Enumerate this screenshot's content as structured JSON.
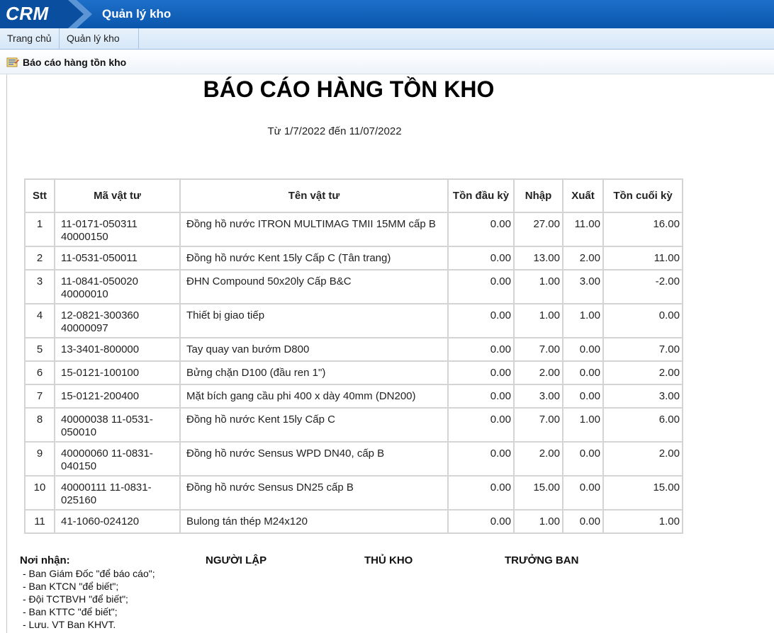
{
  "header": {
    "logo": "CRM",
    "app_title": "Quản lý kho",
    "colors": {
      "topbar": "#0a56ad",
      "menubar": "#dbe9f8"
    }
  },
  "menu": {
    "home": "Trang chủ",
    "warehouse": "Quản lý kho"
  },
  "subbar": {
    "icon": "report-icon",
    "label": "Báo cáo hàng tồn kho"
  },
  "report": {
    "title": "BÁO CÁO HÀNG TỒN KHO",
    "date_range": "Từ 1/7/2022 đến 11/07/2022",
    "columns": [
      "Stt",
      "Mã vật tư",
      "Tên vật tư",
      "Tồn đầu kỳ",
      "Nhập",
      "Xuất",
      "Tồn cuối kỳ"
    ],
    "rows": [
      {
        "stt": "1",
        "ma_line1": "11-0171-050311",
        "ma_line2": "40000150",
        "ten": "Đồng hồ nước ITRON MULTIMAG TMII 15MM cấp B",
        "ton_dau": "0.00",
        "nhap": "27.00",
        "xuat": "11.00",
        "ton_cuoi": "16.00"
      },
      {
        "stt": "2",
        "ma_line1": "11-0531-050011",
        "ma_line2": "",
        "ten": "Đồng hồ nước Kent 15ly Cấp C (Tân trang)",
        "ton_dau": "0.00",
        "nhap": "13.00",
        "xuat": "2.00",
        "ton_cuoi": "11.00"
      },
      {
        "stt": "3",
        "ma_line1": "11-0841-050020",
        "ma_line2": "40000010",
        "ten": "ĐHN Compound 50x20ly Cấp B&C",
        "ton_dau": "0.00",
        "nhap": "1.00",
        "xuat": "3.00",
        "ton_cuoi": "-2.00"
      },
      {
        "stt": "4",
        "ma_line1": "12-0821-300360",
        "ma_line2": "40000097",
        "ten": "Thiết bị giao tiếp",
        "ton_dau": "0.00",
        "nhap": "1.00",
        "xuat": "1.00",
        "ton_cuoi": "0.00"
      },
      {
        "stt": "5",
        "ma_line1": "13-3401-800000",
        "ma_line2": "",
        "ten": "Tay quay van bướm D800",
        "ton_dau": "0.00",
        "nhap": "7.00",
        "xuat": "0.00",
        "ton_cuoi": "7.00"
      },
      {
        "stt": "6",
        "ma_line1": "15-0121-100100",
        "ma_line2": "",
        "ten": "Bửng chặn D100 (đầu ren 1\")",
        "ton_dau": "0.00",
        "nhap": "2.00",
        "xuat": "0.00",
        "ton_cuoi": "2.00"
      },
      {
        "stt": "7",
        "ma_line1": "15-0121-200400",
        "ma_line2": "",
        "ten": "Mặt bích gang cầu phi 400 x dày 40mm (DN200)",
        "ton_dau": "0.00",
        "nhap": "3.00",
        "xuat": "0.00",
        "ton_cuoi": "3.00"
      },
      {
        "stt": "8",
        "ma_line1": "40000038 11-0531-",
        "ma_line2": "050010",
        "ten": "Đồng hồ nước Kent 15ly Cấp C",
        "ton_dau": "0.00",
        "nhap": "7.00",
        "xuat": "1.00",
        "ton_cuoi": "6.00"
      },
      {
        "stt": "9",
        "ma_line1": "40000060 11-0831-",
        "ma_line2": "040150",
        "ten": "Đồng hồ nước Sensus WPD DN40, cấp B",
        "ton_dau": "0.00",
        "nhap": "2.00",
        "xuat": "0.00",
        "ton_cuoi": "2.00"
      },
      {
        "stt": "10",
        "ma_line1": "40000111 11-0831-",
        "ma_line2": "025160",
        "ten": "Đồng hồ nước Sensus DN25 cấp B",
        "ton_dau": "0.00",
        "nhap": "15.00",
        "xuat": "0.00",
        "ton_cuoi": "15.00"
      },
      {
        "stt": "11",
        "ma_line1": "41-1060-024120",
        "ma_line2": "",
        "ten": "Bulong tán thép M24x120",
        "ton_dau": "0.00",
        "nhap": "1.00",
        "xuat": "0.00",
        "ton_cuoi": "1.00"
      }
    ]
  },
  "footer": {
    "recipients_title": "Nơi nhận:",
    "recipients": [
      "- Ban Giám Đốc \"để báo cáo\";",
      "- Ban KTCN \"để biết\";",
      "- Đội TCTBVH \"để biết\";",
      "- Ban KTTC \"để biết\";",
      "- Lưu. VT Ban KHVT."
    ],
    "signers": [
      "NGƯỜI LẬP",
      "THỦ KHO",
      "TRƯỞNG BAN"
    ]
  }
}
